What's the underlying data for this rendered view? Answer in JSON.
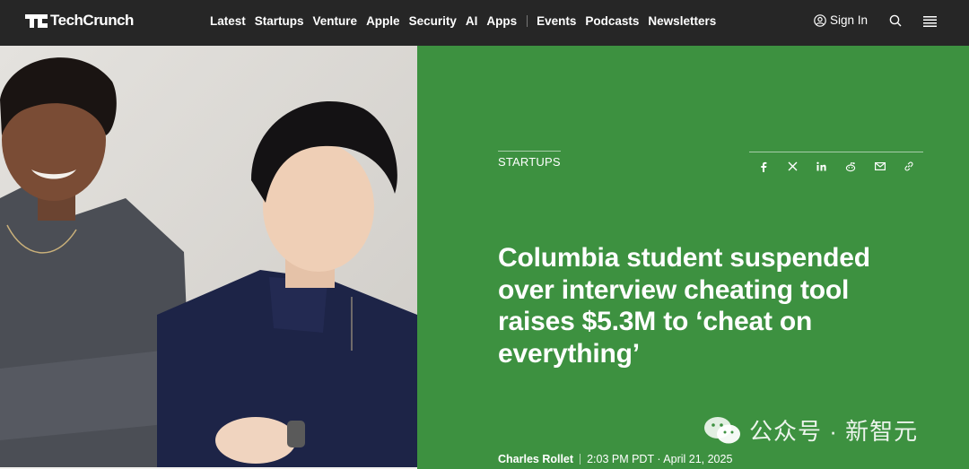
{
  "header": {
    "brand": "TechCrunch",
    "nav_primary": [
      "Latest",
      "Startups",
      "Venture",
      "Apple",
      "Security",
      "AI",
      "Apps"
    ],
    "nav_secondary": [
      "Events",
      "Podcasts",
      "Newsletters"
    ],
    "signin_label": "Sign In"
  },
  "article": {
    "category": "STARTUPS",
    "headline": "Columbia student suspended over interview cheating tool raises $5.3M to ‘cheat on everything’",
    "author": "Charles Rollet",
    "time": "2:03 PM PDT · April 21, 2025",
    "share_icons": [
      "facebook-icon",
      "x-icon",
      "linkedin-icon",
      "reddit-icon",
      "email-icon",
      "link-icon"
    ]
  },
  "watermark": {
    "text": "公众号 · 新智元"
  },
  "colors": {
    "topbar": "#262626",
    "panel_green": "#3d9140",
    "text": "#ffffff"
  }
}
